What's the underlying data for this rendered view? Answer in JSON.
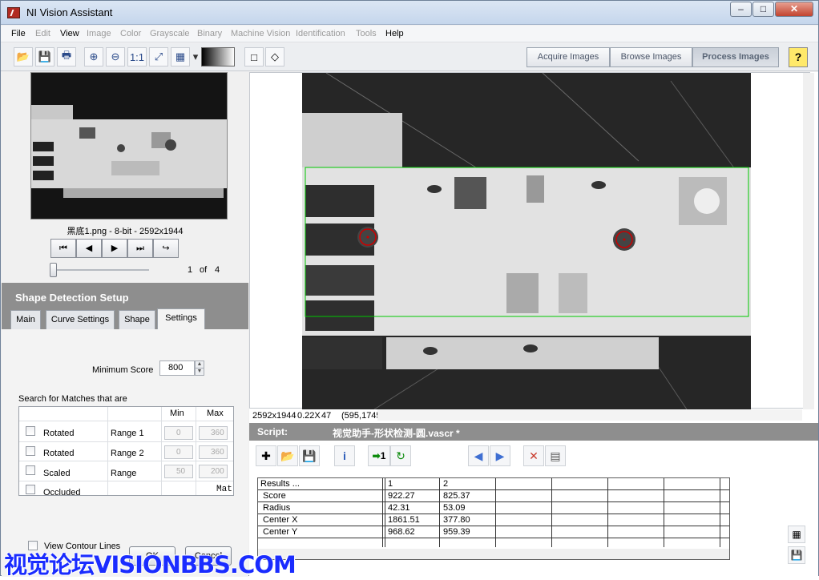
{
  "window": {
    "title": "NI Vision Assistant",
    "minimize": "–",
    "maximize": "□",
    "close": "✕"
  },
  "menu": [
    {
      "label": "File",
      "enabled": true
    },
    {
      "label": "Edit",
      "enabled": false
    },
    {
      "label": "View",
      "enabled": true
    },
    {
      "label": "Image",
      "enabled": false
    },
    {
      "label": "Color",
      "enabled": false
    },
    {
      "label": "Grayscale",
      "enabled": false
    },
    {
      "label": "Binary",
      "enabled": false
    },
    {
      "label": "Machine Vision",
      "enabled": false
    },
    {
      "label": "Identification",
      "enabled": false
    },
    {
      "label": "Tools",
      "enabled": false
    },
    {
      "label": "Help",
      "enabled": true
    }
  ],
  "modes": {
    "acquire": "Acquire Images",
    "browse": "Browse Images",
    "process": "Process Images"
  },
  "help_label": "?",
  "thumbnail": {
    "caption": "黑底1.png - 8-bit - 2592x1944"
  },
  "navigation": {
    "first": "⏮",
    "prev": "◀",
    "next": "▶",
    "last": "⏭",
    "jump": "↪",
    "current": "1",
    "of": "of",
    "total": "4"
  },
  "setup": {
    "title": "Shape Detection Setup",
    "tabs": [
      "Main",
      "Curve Settings",
      "Shape",
      "Settings"
    ],
    "active_tab": "Settings",
    "min_score_label": "Minimum Score",
    "min_score_value": "800",
    "search_label": "Search for Matches that are",
    "grid_headers": {
      "min": "Min",
      "max": "Max"
    },
    "rows": [
      {
        "label": "Rotated",
        "range": "Range 1",
        "min": "0",
        "max": "360"
      },
      {
        "label": "Rotated",
        "range": "Range 2",
        "min": "0",
        "max": "360"
      },
      {
        "label": "Scaled",
        "range": "Range",
        "min": "50",
        "max": "200"
      },
      {
        "label": "Occluded",
        "range": "",
        "min": "",
        "max": "Mat"
      }
    ],
    "view_contour": "View Contour Lines",
    "ok": "OK",
    "cancel": "Cancel"
  },
  "status_bar": {
    "size": "2592x1944",
    "zoom": "0.22X",
    "value": "47",
    "coords": "(595,1745)"
  },
  "script": {
    "label": "Script:",
    "name": "视觉助手-形状检测-圆.vascr *",
    "run_once": "1"
  },
  "results": {
    "headers": [
      "Results ...",
      "1",
      "2"
    ],
    "rows": [
      {
        "name": "Score",
        "c1": "922.27",
        "c2": "825.37"
      },
      {
        "name": "Radius",
        "c1": "42.31",
        "c2": "53.09"
      },
      {
        "name": "Center X",
        "c1": "1861.51",
        "c2": "377.80"
      },
      {
        "name": "Center Y",
        "c1": "968.62",
        "c2": "959.39"
      }
    ]
  },
  "watermark": "视觉论坛VISIONBBS.COM",
  "colors": {
    "accent": "#00c800",
    "marker": "#cc0000",
    "panel_header": "#8e8e8e",
    "watermark": "#1a2cff"
  }
}
